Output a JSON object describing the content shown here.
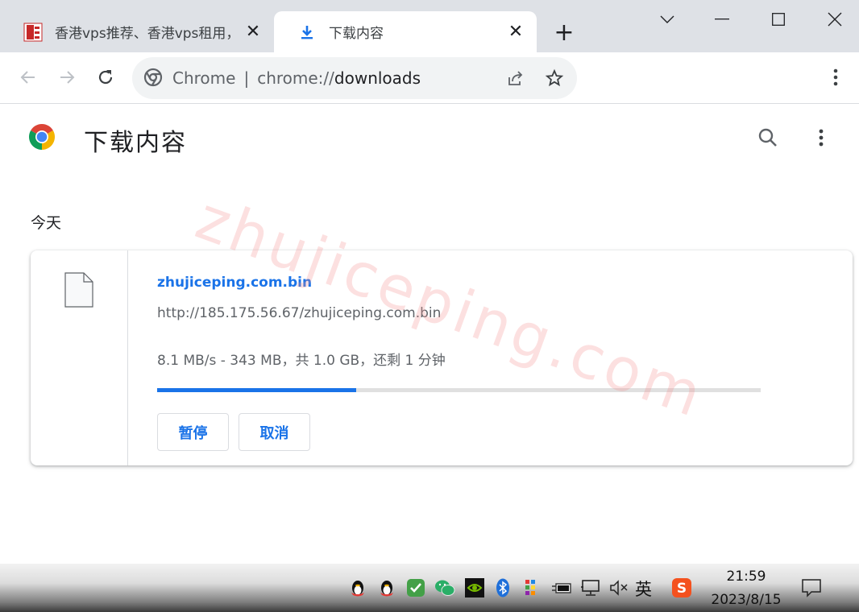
{
  "tabs": [
    {
      "title": "香港vps推荐、香港vps租用，",
      "close": "✕"
    },
    {
      "title": "下载内容",
      "close": "✕"
    }
  ],
  "new_tab": "+",
  "omnibox": {
    "chip": "Chrome",
    "separator": "|",
    "url_scheme": "chrome://",
    "url_host": "downloads"
  },
  "page": {
    "title": "下载内容",
    "section_date": "今天"
  },
  "download": {
    "filename": "zhujiceping.com.bin",
    "url": "http://185.175.56.67/zhujiceping.com.bin",
    "status": "8.1 MB/s - 343 MB，共 1.0 GB，还剩 1 分钟",
    "progress": 0.33,
    "pause_label": "暂停",
    "cancel_label": "取消"
  },
  "watermark": "zhujiceping.com",
  "taskbar": {
    "ime": "英",
    "time": "21:59",
    "date": "2023/8/15"
  },
  "colors": {
    "accent": "#1a73e8",
    "tabstrip": "#dee1e6",
    "omnibox": "#f1f3f4"
  }
}
